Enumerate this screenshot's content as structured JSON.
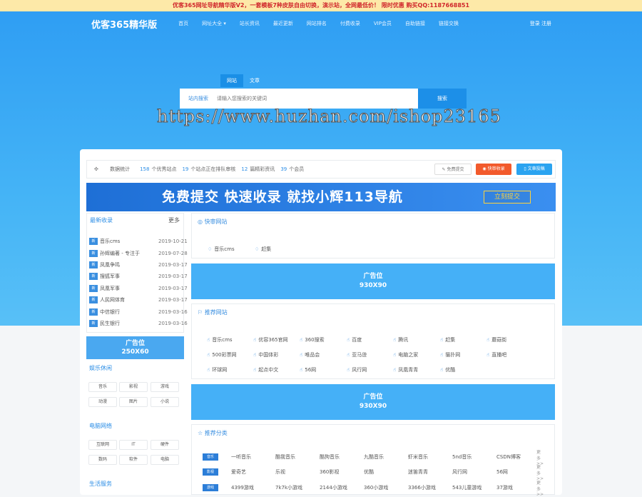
{
  "announcement": "优客365网址导航精华版V2，一套模板7种皮肤自由切换，演示站，全网最低价！ 限时优惠 购买QQ:1187668851",
  "header": {
    "logo": "优客365精华版",
    "nav": [
      "首页",
      "网址大全 ▾",
      "站长资讯",
      "最近更新",
      "网站排名",
      "付费收录",
      "VIP会员",
      "自助链接",
      "链接交换"
    ],
    "auth": "登录  注册"
  },
  "search": {
    "tabs": [
      "网站",
      "文章"
    ],
    "scope": "站内搜索",
    "placeholder": "请输入您搜索的关键词",
    "button": "搜索"
  },
  "watermark": "https://www.huzhan.com/ishop23165",
  "stats": {
    "label": "数据统计",
    "n1": "158",
    "t1": "个优秀站点",
    "n2": "19",
    "t2": "个站点正在排队审核",
    "n3": "12",
    "t3": "篇精彩资讯",
    "n4": "39",
    "t4": "个会员"
  },
  "buttons": {
    "free_submit": "免费提交",
    "fast_submit": "快审收录",
    "article_submit": "文章投稿"
  },
  "banner": {
    "text": "免费提交 快速收录 就找小辉113导航",
    "btn": "立刻提交"
  },
  "latest": {
    "title": "最新收录",
    "more": "更多",
    "badge": "新",
    "items": [
      {
        "name": "音乐cms",
        "date": "2019-10-21"
      },
      {
        "name": "孙辉编著 - 专注于",
        "date": "2019-07-28"
      },
      {
        "name": "凤凰争鸣",
        "date": "2019-03-17"
      },
      {
        "name": "搜狐军事",
        "date": "2019-03-17"
      },
      {
        "name": "凤凰军事",
        "date": "2019-03-17"
      },
      {
        "name": "人民网体育",
        "date": "2019-03-17"
      },
      {
        "name": "中信银行",
        "date": "2019-03-16"
      },
      {
        "name": "民生银行",
        "date": "2019-03-16"
      }
    ]
  },
  "ad_left": {
    "line1": "广告位",
    "line2": "250X60"
  },
  "ent": {
    "title": "娱乐休闲",
    "tags": [
      "音乐",
      "影视",
      "游戏",
      "动漫",
      "图片",
      "小说"
    ]
  },
  "pc": {
    "title": "电脑网络",
    "tags": [
      "互联网",
      "IT",
      "硬件",
      "数码",
      "软件",
      "电脑"
    ]
  },
  "life": {
    "title": "生活服务"
  },
  "fast": {
    "title": "快审网站",
    "items": [
      "音乐cms",
      "赶集"
    ]
  },
  "ad": {
    "line1": "广告位",
    "line2": "930X90"
  },
  "recommend": {
    "title": "推荐网站",
    "items": [
      "音乐cms",
      "优容365官网",
      "360搜索",
      "百度",
      "腾讯",
      "赶集",
      "蘑菇街",
      "500彩票网",
      "中国体彩",
      "唯品会",
      "亚马逊",
      "电脑之家",
      "猫扑网",
      "直播吧",
      "环球网",
      "起点中文",
      "56网",
      "风行网",
      "凤凰青青",
      "优酷"
    ]
  },
  "cats": {
    "title": "推荐分类",
    "more": "更多>>",
    "rows": [
      {
        "tag": "音乐",
        "links": [
          "一听音乐",
          "酷我音乐",
          "酷狗音乐",
          "九酷音乐",
          "虾米音乐",
          "5nd音乐",
          "CSDN博客"
        ]
      },
      {
        "tag": "影视",
        "links": [
          "爱奇艺",
          "乐视",
          "360影视",
          "优酷",
          "迷笛青青",
          "风行网",
          "56网"
        ]
      },
      {
        "tag": "游戏",
        "links": [
          "4399游戏",
          "7k7k小游戏",
          "2144小游戏",
          "360小游戏",
          "3366小游戏",
          "543儿童游戏",
          "37游戏"
        ]
      }
    ]
  }
}
